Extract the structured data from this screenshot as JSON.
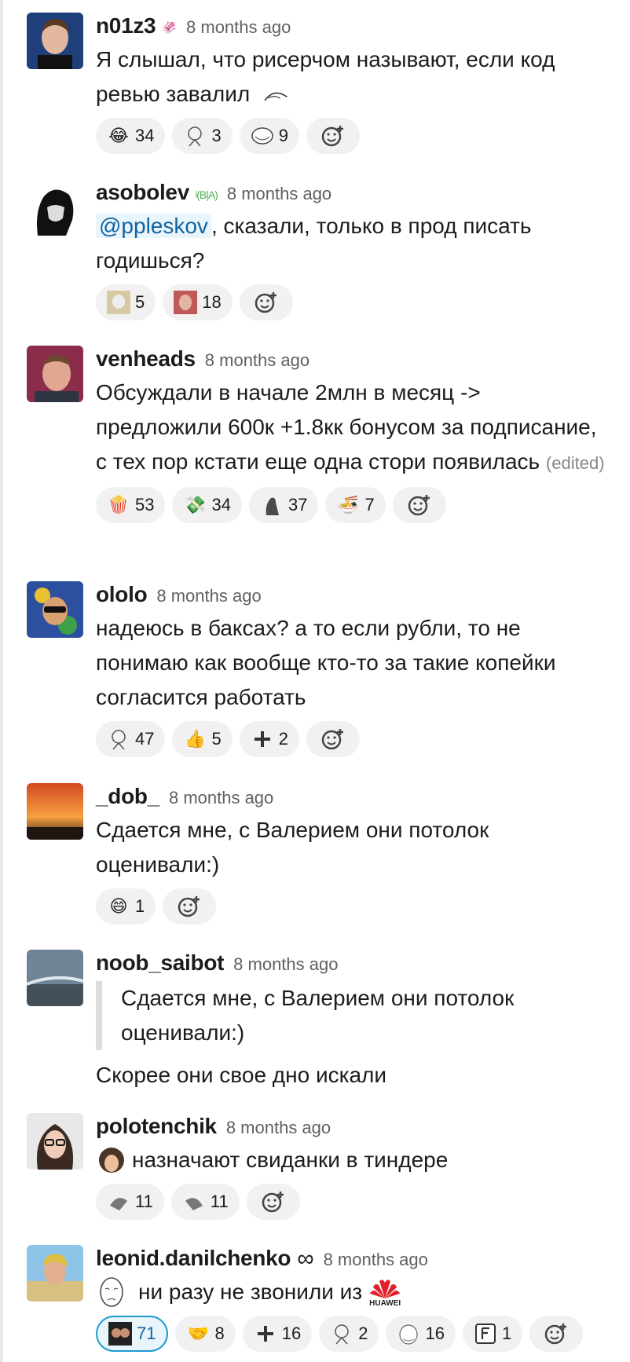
{
  "messages": [
    {
      "username": "n01z3",
      "badge": "🦑",
      "time": "8 months ago",
      "text": "Я слышал, что рисерчом называют, если код ревью завалил",
      "text_emoji": "troll-face",
      "reactions": [
        {
          "emoji": "joy",
          "count": "34"
        },
        {
          "emoji": "rage-guy",
          "count": "3"
        },
        {
          "emoji": "troll-face",
          "count": "9"
        }
      ]
    },
    {
      "username": "asobolev",
      "badge": "ʲ(B|A)",
      "time": "8 months ago",
      "mention": "@ppleskov",
      "text": ", сказали, только в прод писать годишься?",
      "reactions": [
        {
          "emoji": "old-man",
          "count": "5"
        },
        {
          "emoji": "hide-pain",
          "count": "18"
        }
      ]
    },
    {
      "username": "venheads",
      "time": "8 months ago",
      "text": "Обсуждали в начале 2млн в месяц -> предложили 600к +1.8кк бонусом за подписание, с тех пор кстати  еще одна стори появилась",
      "edited": "(edited)",
      "reactions": [
        {
          "emoji": "popcorn",
          "count": "53"
        },
        {
          "emoji": "money",
          "count": "34"
        },
        {
          "emoji": "seal",
          "count": "37"
        },
        {
          "emoji": "ramen",
          "count": "7"
        }
      ]
    },
    {
      "username": "ololo",
      "time": "8 months ago",
      "text": "надеюсь в баксах? а то если рубли, то не понимаю как вообще кто-то за такие копейки согласится работать",
      "reactions": [
        {
          "emoji": "rage-guy",
          "count": "47"
        },
        {
          "emoji": "thumbsup",
          "count": "5"
        },
        {
          "emoji": "plus",
          "count": "2"
        }
      ]
    },
    {
      "username": "_dob_",
      "time": "8 months ago",
      "text": "Сдается мне, с Валерием они потолок оценивали:)",
      "reactions": [
        {
          "emoji": "smile",
          "count": "1"
        }
      ]
    },
    {
      "username": "noob_saibot",
      "time": "8 months ago",
      "quote": "Сдается мне, с Валерием они потолок оценивали:)",
      "text": "Скорее они свое дно искали"
    },
    {
      "username": "polotenchik",
      "time": "8 months ago",
      "text": "назначают свиданки в тиндере",
      "text_emoji": "bob-ross",
      "reactions": [
        {
          "emoji": "parrot",
          "count": "11"
        },
        {
          "emoji": "parrot-2",
          "count": "11"
        }
      ]
    },
    {
      "username": "leonid.danilchenko",
      "badge": "∞",
      "time": "8 months ago",
      "text": "ни разу не звонили из",
      "text_emoji": "okay-face",
      "brand": "HUAWEI",
      "reactions": [
        {
          "emoji": "photo",
          "count": "71",
          "active": true
        },
        {
          "emoji": "handshake",
          "count": "8"
        },
        {
          "emoji": "plus",
          "count": "16"
        },
        {
          "emoji": "rage-guy",
          "count": "2"
        },
        {
          "emoji": "sketch",
          "count": "16"
        },
        {
          "emoji": "f-key",
          "count": "1"
        }
      ]
    }
  ]
}
